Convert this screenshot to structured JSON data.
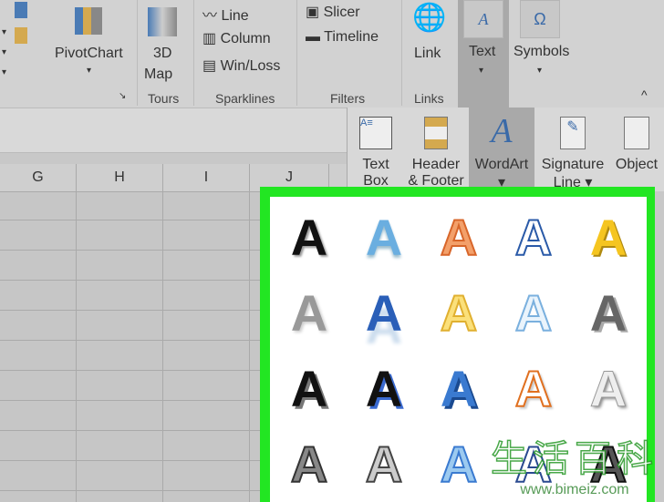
{
  "ribbon": {
    "pivotchart": "PivotChart",
    "map3d_line1": "3D",
    "map3d_line2": "Map",
    "tours": "Tours",
    "sparklines": {
      "line": "Line",
      "column": "Column",
      "winloss": "Win/Loss",
      "group": "Sparklines"
    },
    "filters": {
      "slicer": "Slicer",
      "timeline": "Timeline",
      "group": "Filters"
    },
    "link": "Link",
    "links_group": "Links",
    "text": "Text",
    "symbols": "Symbols"
  },
  "columns": [
    "G",
    "H",
    "I",
    "J"
  ],
  "text_dropdown": {
    "items": [
      {
        "label": "Text",
        "label2": "Box",
        "icon": "text-box-icon"
      },
      {
        "label": "Header",
        "label2": "& Footer",
        "icon": "header-footer-icon"
      },
      {
        "label": "WordArt",
        "label2": "▾",
        "icon": "wordart-icon"
      },
      {
        "label": "Signature",
        "label2": "Line ▾",
        "icon": "signature-line-icon"
      },
      {
        "label": "Object",
        "label2": "",
        "icon": "object-icon"
      }
    ]
  },
  "wordart_gallery": {
    "letter": "A",
    "highlight_color": "#22e622"
  },
  "watermark": {
    "chars": "生活百科",
    "url": "www.bimeiz.com"
  }
}
